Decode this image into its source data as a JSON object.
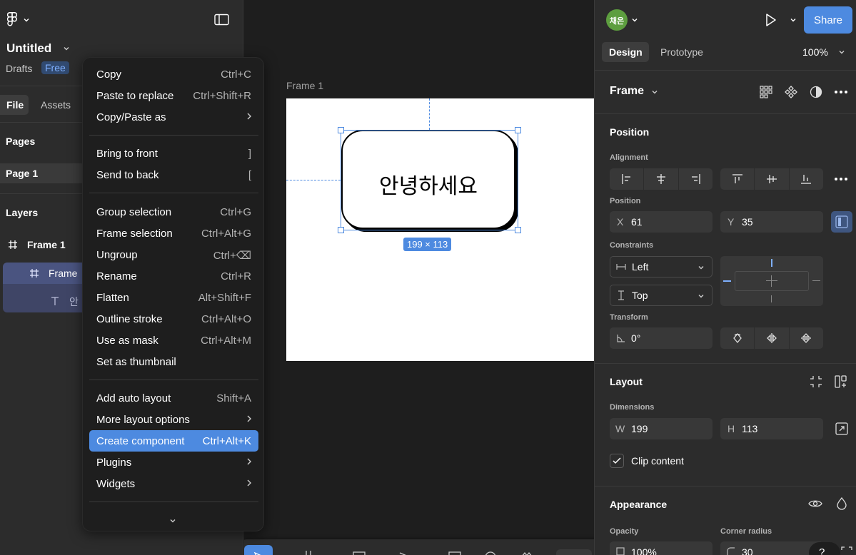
{
  "file": {
    "title": "Untitled",
    "location": "Drafts",
    "plan_badge": "Free"
  },
  "left_tabs": {
    "file": "File",
    "assets": "Assets"
  },
  "pages": {
    "heading": "Pages",
    "items": [
      "Page 1"
    ]
  },
  "layers": {
    "heading": "Layers",
    "items": [
      {
        "label": "Frame 1"
      },
      {
        "label": "Frame"
      },
      {
        "label": "안"
      }
    ]
  },
  "context_menu": {
    "groups": [
      [
        {
          "label": "Copy",
          "shortcut": "Ctrl+C"
        },
        {
          "label": "Paste to replace",
          "shortcut": "Ctrl+Shift+R"
        },
        {
          "label": "Copy/Paste as",
          "shortcut": ""
        }
      ],
      [
        {
          "label": "Bring to front",
          "shortcut": "]"
        },
        {
          "label": "Send to back",
          "shortcut": "["
        }
      ],
      [
        {
          "label": "Group selection",
          "shortcut": "Ctrl+G"
        },
        {
          "label": "Frame selection",
          "shortcut": "Ctrl+Alt+G"
        },
        {
          "label": "Ungroup",
          "shortcut": "Ctrl+⌫"
        },
        {
          "label": "Rename",
          "shortcut": "Ctrl+R"
        },
        {
          "label": "Flatten",
          "shortcut": "Alt+Shift+F"
        },
        {
          "label": "Outline stroke",
          "shortcut": "Ctrl+Alt+O"
        },
        {
          "label": "Use as mask",
          "shortcut": "Ctrl+Alt+M"
        },
        {
          "label": "Set as thumbnail",
          "shortcut": ""
        }
      ],
      [
        {
          "label": "Add auto layout",
          "shortcut": "Shift+A"
        },
        {
          "label": "More layout options",
          "shortcut": ""
        },
        {
          "label": "Create component",
          "shortcut": "Ctrl+Alt+K"
        },
        {
          "label": "Plugins",
          "shortcut": ""
        },
        {
          "label": "Widgets",
          "shortcut": ""
        }
      ]
    ]
  },
  "canvas": {
    "frame_label": "Frame 1",
    "selected_text": "안녕하세요",
    "size_badge": "199 × 113"
  },
  "header": {
    "avatar_text": "채은",
    "share_label": "Share",
    "tab_design": "Design",
    "tab_prototype": "Prototype",
    "zoom": "100%"
  },
  "properties": {
    "frame_type": "Frame",
    "position_section": "Position",
    "alignment_label": "Alignment",
    "position_label": "Position",
    "x_label": "X",
    "x_value": "61",
    "y_label": "Y",
    "y_value": "35",
    "constraints_label": "Constraints",
    "constraint_h": "Left",
    "constraint_v": "Top",
    "transform_label": "Transform",
    "rotation": "0°",
    "layout_section": "Layout",
    "dimensions_label": "Dimensions",
    "w_label": "W",
    "w_value": "199",
    "h_label": "H",
    "h_value": "113",
    "clip_content": "Clip content",
    "appearance_section": "Appearance",
    "opacity_label": "Opacity",
    "opacity_value": "100%",
    "corner_radius_label": "Corner radius",
    "corner_radius_value": "30"
  },
  "colors": {
    "accent": "#4d8ae0",
    "selection": "#4d8ae0",
    "avatar_bg": "#5d9e3f",
    "panel_bg": "#2c2c2c",
    "canvas_bg": "#1e1e1e"
  }
}
